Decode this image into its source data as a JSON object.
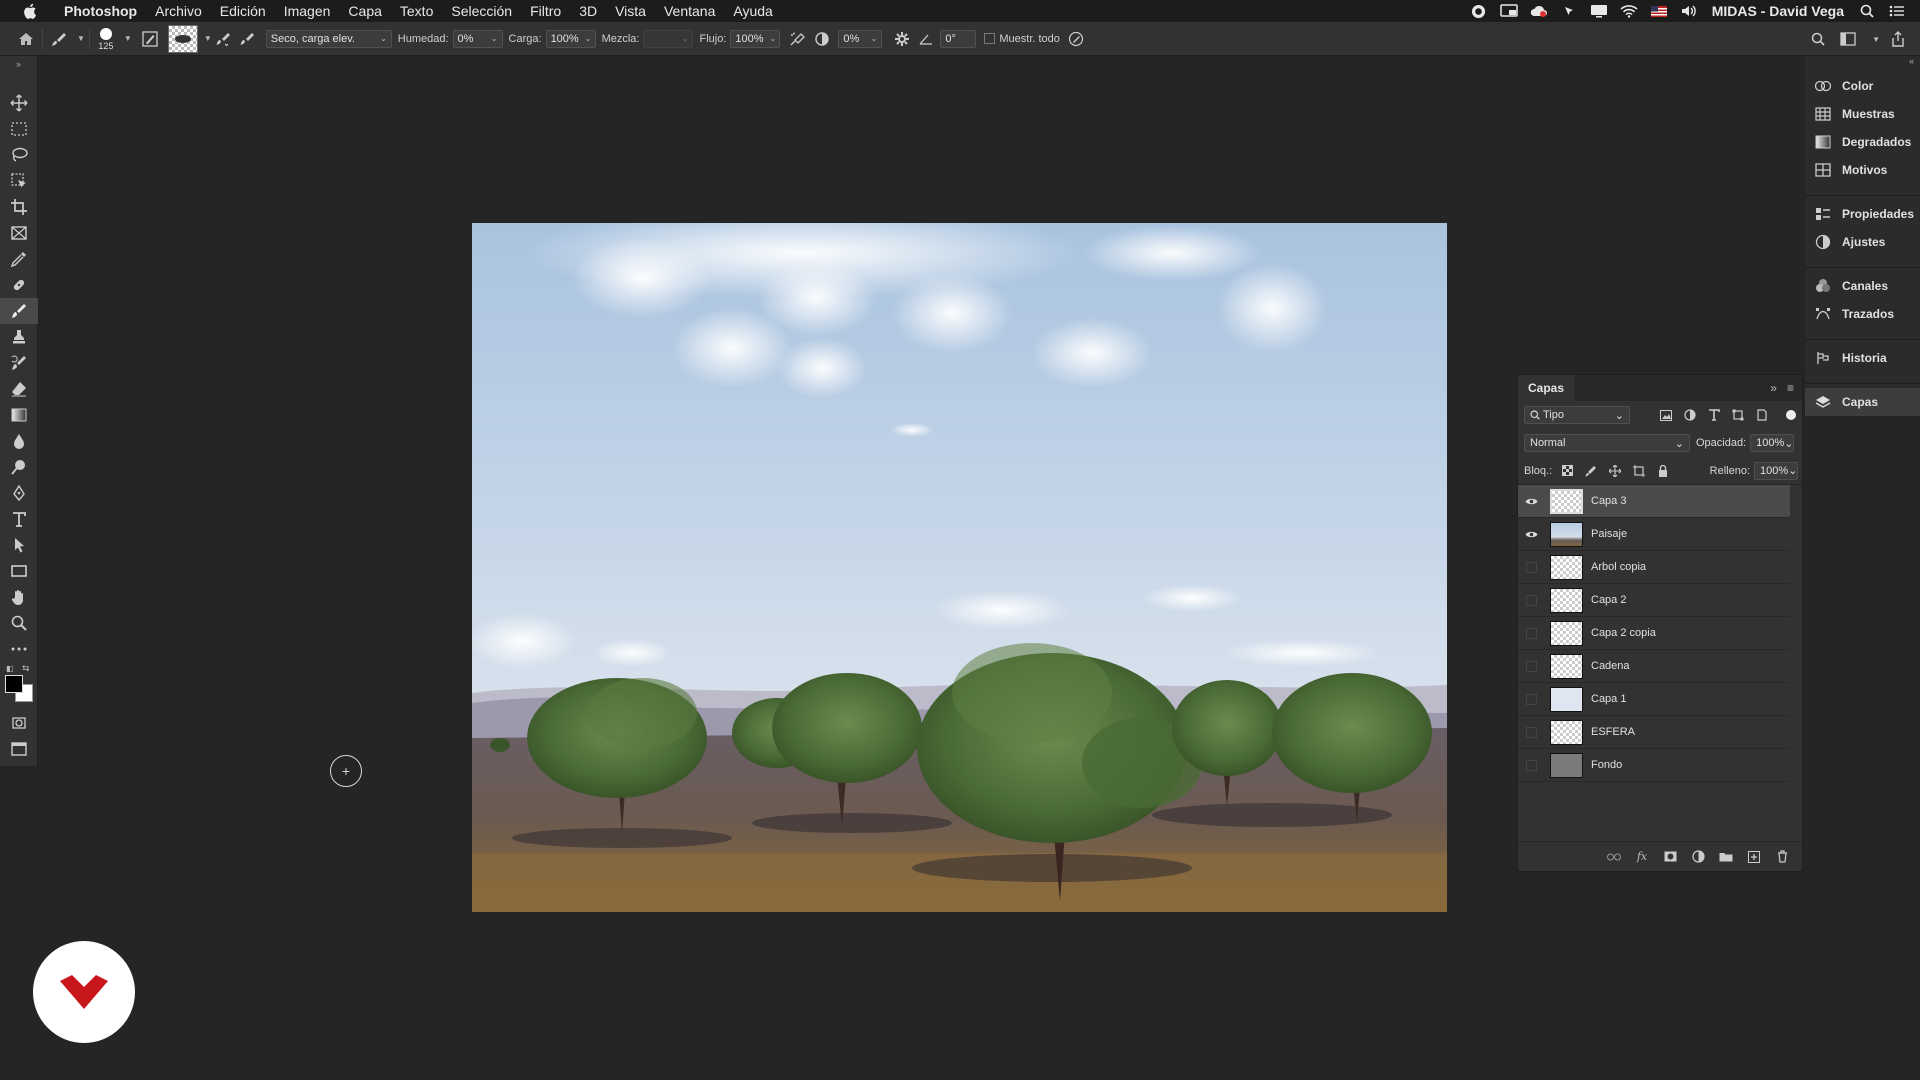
{
  "menubar": {
    "app_name": "Photoshop",
    "items": [
      "Archivo",
      "Edición",
      "Imagen",
      "Capa",
      "Texto",
      "Selección",
      "Filtro",
      "3D",
      "Vista",
      "Ventana",
      "Ayuda"
    ],
    "user": "MIDAS - David Vega",
    "status_icons": [
      "record-icon",
      "cast-icon",
      "cloud-icon",
      "cursor-icon",
      "display-icon",
      "wifi-icon",
      "flag-icon",
      "volume-icon",
      "search-icon",
      "list-icon"
    ]
  },
  "options": {
    "brush_size": "125",
    "brush_preset": "Seco, carga elev.",
    "humedad_label": "Humedad:",
    "humedad_value": "0%",
    "carga_label": "Carga:",
    "carga_value": "100%",
    "mezcla_label": "Mezcla:",
    "mezcla_value": "",
    "flujo_label": "Flujo:",
    "flujo_value": "100%",
    "smooth_value": "0%",
    "angle_value": "0°",
    "sample_all_label": "Muestr. todo"
  },
  "tools": [
    "move-tool-icon",
    "marquee-tool-icon",
    "lasso-tool-icon",
    "object-select-tool-icon",
    "crop-tool-icon",
    "frame-tool-icon",
    "eyedropper-tool-icon",
    "healing-tool-icon",
    "mixer-brush-tool-icon",
    "stamp-tool-icon",
    "history-brush-tool-icon",
    "eraser-tool-icon",
    "gradient-tool-icon",
    "blur-tool-icon",
    "dodge-tool-icon",
    "pen-tool-icon",
    "type-tool-icon",
    "path-select-tool-icon",
    "rectangle-tool-icon",
    "hand-tool-icon",
    "zoom-tool-icon",
    "more-tools-icon"
  ],
  "active_tool": "mixer-brush-tool-icon",
  "dock": {
    "items": [
      {
        "label": "Color",
        "icon": "color-icon"
      },
      {
        "label": "Muestras",
        "icon": "swatches-icon"
      },
      {
        "label": "Degradados",
        "icon": "gradients-icon"
      },
      {
        "label": "Motivos",
        "icon": "patterns-icon"
      },
      {
        "label": "Propiedades",
        "icon": "properties-icon"
      },
      {
        "label": "Ajustes",
        "icon": "adjustments-icon"
      },
      {
        "label": "Canales",
        "icon": "channels-icon"
      },
      {
        "label": "Trazados",
        "icon": "paths-icon"
      },
      {
        "label": "Historia",
        "icon": "history-icon"
      },
      {
        "label": "Capas",
        "icon": "layers-icon"
      }
    ]
  },
  "layers_panel": {
    "tab": "Capas",
    "filter_type": "Tipo",
    "blend_mode": "Normal",
    "opacity_label": "Opacidad:",
    "opacity_value": "100%",
    "lock_label": "Bloq.:",
    "fill_label": "Relleno:",
    "fill_value": "100%",
    "layers": [
      {
        "name": "Capa 3",
        "visible": true,
        "selected": true
      },
      {
        "name": "Paisaje",
        "visible": true,
        "selected": false
      },
      {
        "name": "Arbol copia",
        "visible": false,
        "selected": false
      },
      {
        "name": "Capa 2",
        "visible": false,
        "selected": false
      },
      {
        "name": "Capa 2 copia",
        "visible": false,
        "selected": false
      },
      {
        "name": "Cadena",
        "visible": false,
        "selected": false
      },
      {
        "name": "Capa 1",
        "visible": false,
        "selected": false
      },
      {
        "name": "ESFERA",
        "visible": false,
        "selected": false
      },
      {
        "name": "Fondo",
        "visible": false,
        "selected": false
      }
    ]
  },
  "colors": {
    "accent_logo": "#c8161d",
    "workspace": "#252525",
    "panel": "#323232"
  }
}
